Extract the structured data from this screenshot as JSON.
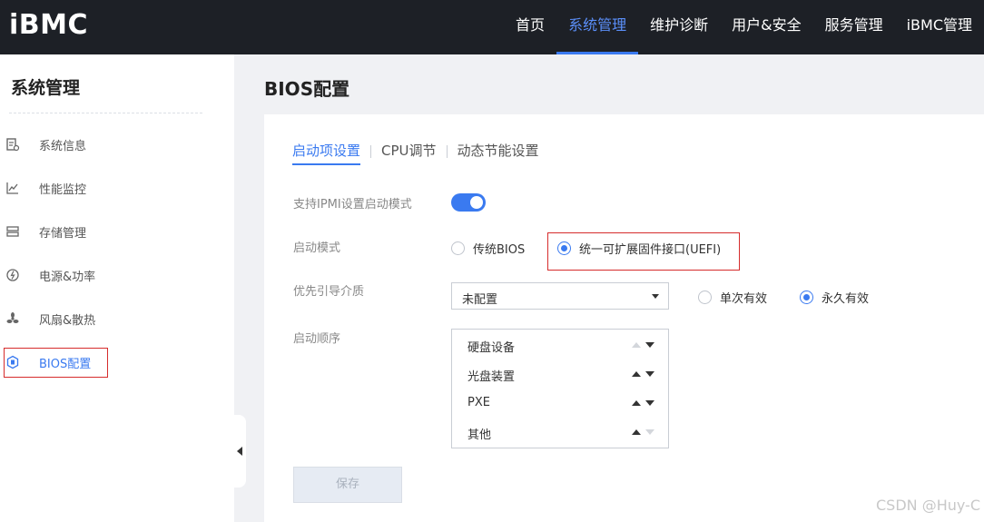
{
  "header": {
    "logo": "iBMC",
    "nav": [
      {
        "label": "首页"
      },
      {
        "label": "系统管理"
      },
      {
        "label": "维护诊断"
      },
      {
        "label": "用户&安全"
      },
      {
        "label": "服务管理"
      },
      {
        "label": "iBMC管理"
      }
    ],
    "active_nav": "系统管理"
  },
  "sidebar": {
    "title": "系统管理",
    "items": [
      {
        "label": "系统信息",
        "icon": "system-info-icon"
      },
      {
        "label": "性能监控",
        "icon": "line-chart-icon"
      },
      {
        "label": "存储管理",
        "icon": "storage-icon"
      },
      {
        "label": "电源&功率",
        "icon": "power-icon"
      },
      {
        "label": "风扇&散热",
        "icon": "fan-icon"
      },
      {
        "label": "BIOS配置",
        "icon": "bios-icon"
      }
    ],
    "active_item": "BIOS配置"
  },
  "main": {
    "title": "BIOS配置",
    "tabs": [
      {
        "label": "启动项设置"
      },
      {
        "label": "CPU调节"
      },
      {
        "label": "动态节能设置"
      }
    ],
    "active_tab": "启动项设置",
    "form": {
      "ipmi_label": "支持IPMI设置启动模式",
      "ipmi_enabled": true,
      "boot_mode_label": "启动模式",
      "boot_mode_options": [
        "传统BIOS",
        "统一可扩展固件接口(UEFI)"
      ],
      "boot_mode_selected": "统一可扩展固件接口(UEFI)",
      "priority_label": "优先引导介质",
      "priority_value": "未配置",
      "validity_options": [
        "单次有效",
        "永久有效"
      ],
      "validity_selected": "永久有效",
      "order_label": "启动顺序",
      "order_items": [
        "硬盘设备",
        "光盘装置",
        "PXE",
        "其他"
      ],
      "save_label": "保存"
    }
  },
  "watermark": "CSDN @Huy-C",
  "colors": {
    "topbar_bg": "#1d2026",
    "accent": "#3a7af0",
    "highlight_box": "#d62c2c"
  }
}
